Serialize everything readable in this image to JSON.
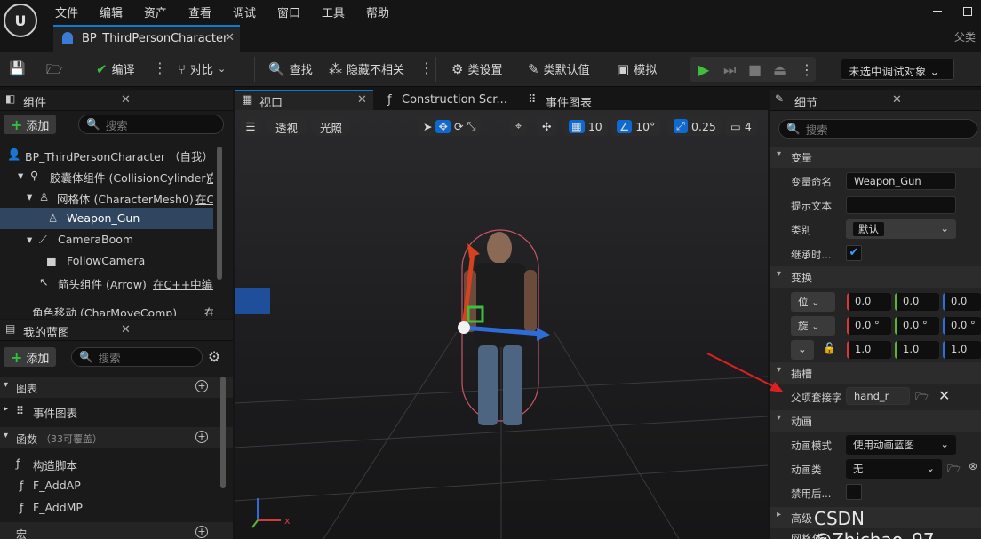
{
  "menu": [
    "文件",
    "编辑",
    "资产",
    "查看",
    "调试",
    "窗口",
    "工具",
    "帮助"
  ],
  "document_tab": "BP_ThirdPersonCharacter",
  "parent_label": "父类",
  "toolbar": {
    "compile": "编译",
    "diff": "对比",
    "find": "查找",
    "hide_unrelated": "隐藏不相关",
    "class_settings": "类设置",
    "class_defaults": "类默认值",
    "simulate": "模拟",
    "debug_target": "未选中调试对象"
  },
  "components": {
    "title": "组件",
    "add": "添加",
    "search_placeholder": "搜索",
    "tree": [
      {
        "label": "BP_ThirdPersonCharacter （自我）"
      },
      {
        "label": "胶囊体组件 (CollisionCylinder)",
        "suffix": "在"
      },
      {
        "label": "网格体 (CharacterMesh0)",
        "suffix": "在C"
      },
      {
        "label": "Weapon_Gun"
      },
      {
        "label": "CameraBoom"
      },
      {
        "label": "FollowCamera"
      },
      {
        "label": "箭头组件 (Arrow)",
        "suffix": "在C++中编辑"
      },
      {
        "label": "角色移动 (CharMoveComp)",
        "suffix": "在C"
      }
    ]
  },
  "blueprint": {
    "title": "我的蓝图",
    "add": "添加",
    "search_placeholder": "搜索",
    "graphs_header": "图表",
    "event_graph": "事件图表",
    "functions_header": "函数",
    "functions_count": "（33可覆盖）",
    "functions": [
      "构造脚本",
      "F_AddAP",
      "F_AddMP"
    ],
    "macros_header": "宏"
  },
  "viewport": {
    "tabs": [
      "视口",
      "Construction Scr...",
      "事件图表"
    ],
    "perspective": "透视",
    "lit": "光照",
    "grid_snap": "10",
    "rot_snap": "10°",
    "scale_snap": "0.25",
    "camera_speed": "4",
    "axis_x": "x"
  },
  "details": {
    "title": "细节",
    "search_placeholder": "搜索",
    "section_variable": "变量",
    "var_name_label": "变量命名",
    "var_name_value": "Weapon_Gun",
    "tooltip_label": "提示文本",
    "category_label": "类别",
    "category_value": "默认",
    "inherit_label": "继承时...",
    "section_transform": "变换",
    "loc_label": "位",
    "rot_label": "旋",
    "loc": [
      "0.0",
      "0.0",
      "0.0"
    ],
    "rot": [
      "0.0 °",
      "0.0 °",
      "0.0 °"
    ],
    "scale": [
      "1.0",
      "1.0",
      "1.0"
    ],
    "section_socket": "插槽",
    "parent_socket_label": "父项套接字",
    "parent_socket_value": "hand_r",
    "section_animation": "动画",
    "anim_mode_label": "动画模式",
    "anim_mode_value": "使用动画蓝图",
    "anim_class_label": "动画类",
    "anim_class_value": "无",
    "disable_post_label": "禁用后...",
    "section_advanced": "高级",
    "section_mesh": "网格体"
  },
  "watermark": "CSDN @Zhichao_97"
}
